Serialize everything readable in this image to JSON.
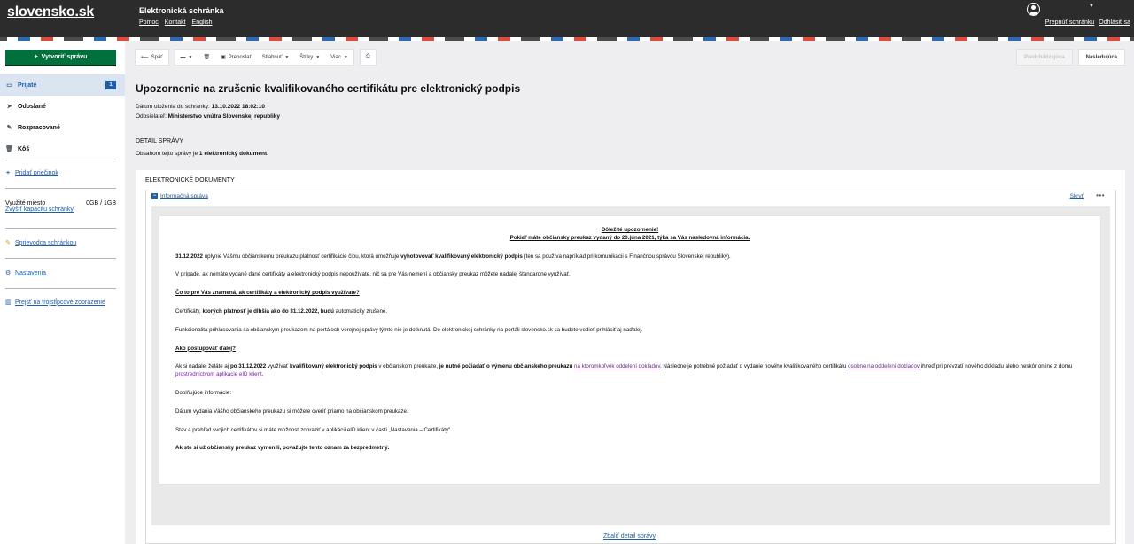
{
  "header": {
    "logo": "slovensko.sk",
    "service_title": "Elektronická schránka",
    "links": [
      "Pomoc",
      "Kontakt",
      "English"
    ],
    "switch_mailbox": "Prepnúť schránku",
    "logout": "Odhlásiť sa"
  },
  "sidebar": {
    "create_button": "Vytvoriť správu",
    "items": [
      {
        "label": "Prijaté",
        "icon": "inbox-icon",
        "badge": "1",
        "active": true
      },
      {
        "label": "Odoslané",
        "icon": "send-icon"
      },
      {
        "label": "Rozpracované",
        "icon": "pencil-icon"
      },
      {
        "label": "Kôš",
        "icon": "trash-icon"
      }
    ],
    "add_folder": "Pridať priečinok",
    "storage_label": "Využité miesto",
    "storage_value": "0GB / 1GB",
    "increase_capacity": "Zvýšiť kapacitu schránky",
    "guide": "Sprievodca schránkou",
    "settings": "Nastavenia",
    "three_column": "Prejsť na trojstĺpcové zobrazenie"
  },
  "toolbar": {
    "back": "Späť",
    "forward": "Preposlať",
    "download": "Stiahnuť",
    "labels": "Štítky",
    "more": "Viac",
    "previous": "Predchádzajúca",
    "next": "Nasledujúca"
  },
  "message": {
    "title": "Upozornenie na zrušenie kvalifikovaného certifikátu pre elektronický podpis",
    "date_label": "Dátum uloženia do schránky:",
    "date_value": "13.10.2022 18:02:10",
    "sender_label": "Odosielateľ:",
    "sender_value": "Ministerstvo vnútra Slovenskej republiky",
    "detail_heading": "DETAIL SPRÁVY",
    "content_prefix": "Obsahom tejto správy je",
    "content_bold": "1 elektronický dokument",
    "content_suffix": ".",
    "documents_heading": "ELEKTRONICKÉ DOKUMENTY",
    "document_name": "Informačná správa",
    "hide": "Skryť",
    "show_detail": "Zbaliť detail správy"
  },
  "document": {
    "head1": "Dôležité upozornenie!",
    "head2": "Pokiaľ máte občiansky preukaz vydaný do 20.júna 2021, týka sa Vás nasledovná informácia.",
    "p1_b1": "31.12.2022",
    "p1_t1": " uplynie Vášmu občianskemu preukazu platnosť certifikácie čipu, ktorá umožňuje ",
    "p1_b2": "vyhotovovať kvalifikovaný elektronický podpis",
    "p1_t2": " (ten sa používa napríklad pri komunikácii s Finančnou správou Slovenskej republiky).",
    "p2": "V prípade, ak nemáte vydané dané certifikáty a elektronický podpis nepoužívate, nič sa pre Vás nemení a občiansky preukaz môžete naďalej štandardne využívať.",
    "sub1": "Čo to pre Vás znamená, ak certifikáty a elektronický podpis využívate?",
    "p3_t1": "Certifikáty, ",
    "p3_b1": "ktorých platnosť je dlhšia ako do 31.12.2022, budú",
    "p3_t2": " automaticky zrušené.",
    "p4": "Funkcionalita prihlasovania sa občianskym preukazom na portáloch verejnej správy týmto nie je dotknutá. Do elektronickej schránky na portáli slovensko.sk sa budete vedieť prihlásiť aj naďalej.",
    "sub2": "Ako postupovať ďalej?",
    "p5_t1": "Ak si naďalej želáte aj ",
    "p5_b1": "po 31.12.2022",
    "p5_t2": " využívať ",
    "p5_b2": "kvalifikovaný elektronický podpis",
    "p5_t3": " v občianskom preukaze, ",
    "p5_b3": "je nutné požiadať o výmenu občianskeho preukazu",
    "p5_t4": " ",
    "p5_l1": "na ktoromkoľvek oddelení dokladov",
    "p5_t5": ". Následne je potrebné požiadať o vydanie nového kvalifikovaného certifikátu ",
    "p5_l2": "osobne na oddelení dokladov",
    "p5_t6": " ihneď pri prevzatí nového dokladu alebo neskôr online z domu ",
    "p5_l3": "prostredníctvom aplikácie eID klient",
    "p5_t7": ".",
    "p6": "Doplňujúce informácie:",
    "p7": "Dátum vydania Vášho občianskeho preukazu si môžete overiť priamo na občianskom preukaze.",
    "p8": "Stav a prehľad svojich certifikátov si máte možnosť zobraziť v aplikácii eID klient v časti „Nastavenia – Certifikáty\".",
    "p9": "Ak ste si už občiansky preukaz vymenili, považujte tento oznam za bezpredmetný."
  },
  "colors": {
    "header_bg": "#2c2c2c",
    "create_button": "#00703c",
    "link": "#1d5ea8",
    "active_nav_bg": "#dbe5f1"
  }
}
